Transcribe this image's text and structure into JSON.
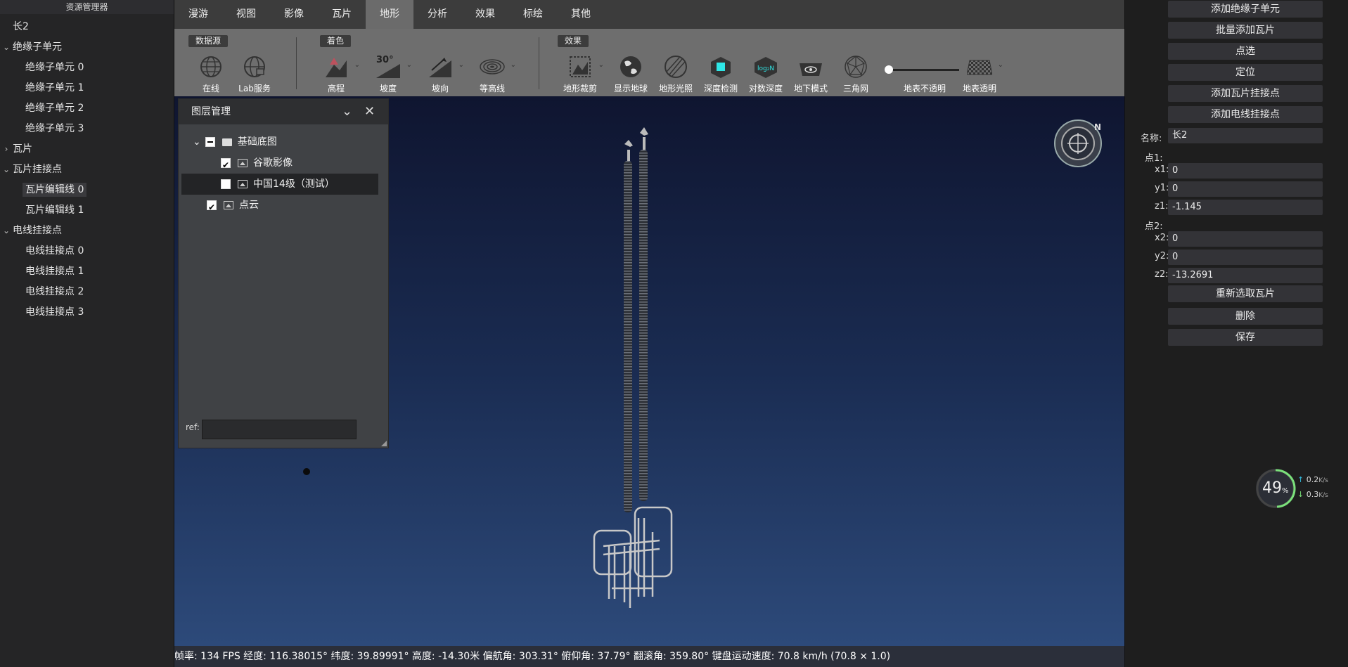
{
  "left_panel": {
    "title": "资源管理器",
    "root": "长2",
    "groups": [
      {
        "label": "绝缘子单元",
        "items": [
          "绝缘子单元 0",
          "绝缘子单元 1",
          "绝缘子单元 2",
          "绝缘子单元 3"
        ]
      },
      {
        "label": "瓦片",
        "items": []
      },
      {
        "label": "瓦片挂接点",
        "items": [
          "瓦片编辑线 0",
          "瓦片编辑线 1"
        ]
      },
      {
        "label": "电线挂接点",
        "items": [
          "电线挂接点 0",
          "电线挂接点 1",
          "电线挂接点 2",
          "电线挂接点 3"
        ]
      }
    ]
  },
  "menu": {
    "tabs": [
      "漫游",
      "视图",
      "影像",
      "瓦片",
      "地形",
      "分析",
      "效果",
      "标绘",
      "其他"
    ],
    "active": "地形"
  },
  "ribbon": {
    "groups": [
      "数据源",
      "着色",
      "效果"
    ],
    "buttons": [
      "在线",
      "Lab服务",
      "高程",
      "坡度",
      "坡向",
      "等高线",
      "地形裁剪",
      "显示地球",
      "地形光照",
      "深度检测",
      "对数深度",
      "地下模式",
      "三角网",
      "地表不透明",
      "地表透明"
    ],
    "slope_icon_text": "30°",
    "log_icon_text": "log₂N"
  },
  "layers": {
    "title": "图层管理",
    "items": [
      {
        "label": "基础底图",
        "state": "partial"
      },
      {
        "label": "谷歌影像",
        "state": "checked"
      },
      {
        "label": "中国14级（测试）",
        "state": "unchecked"
      },
      {
        "label": "点云",
        "state": "checked"
      }
    ],
    "ref_label": "ref:",
    "ref_value": ""
  },
  "compass": {
    "north_label": "N"
  },
  "status_bar": "帧率: 134 FPS 经度: 116.38015° 纬度: 39.89991° 高度: -14.30米 偏航角: 303.31° 俯仰角: 37.79° 翻滚角: 359.80° 键盘运动速度: 70.8 km/h (70.8 × 1.0)",
  "right_panel": {
    "buttons_top": [
      "添加绝缘子单元",
      "批量添加瓦片",
      "点选",
      "定位",
      "添加瓦片挂接点",
      "添加电线挂接点"
    ],
    "name_label": "名称:",
    "name_value": "长2",
    "point1_label": "点1:",
    "x1_label": "x1:",
    "x1": "0",
    "y1_label": "y1:",
    "y1": "0",
    "z1_label": "z1:",
    "z1": "-1.145",
    "point2_label": "点2:",
    "x2_label": "x2:",
    "x2": "0",
    "y2_label": "y2:",
    "y2": "0",
    "z2_label": "z2:",
    "z2": "-13.2691",
    "buttons_bottom": [
      "重新选取瓦片",
      "删除",
      "保存"
    ]
  },
  "net_meter": {
    "percent": "49",
    "percent_unit": "%",
    "up": "0.2",
    "down": "0.3",
    "unit": "K/s"
  }
}
